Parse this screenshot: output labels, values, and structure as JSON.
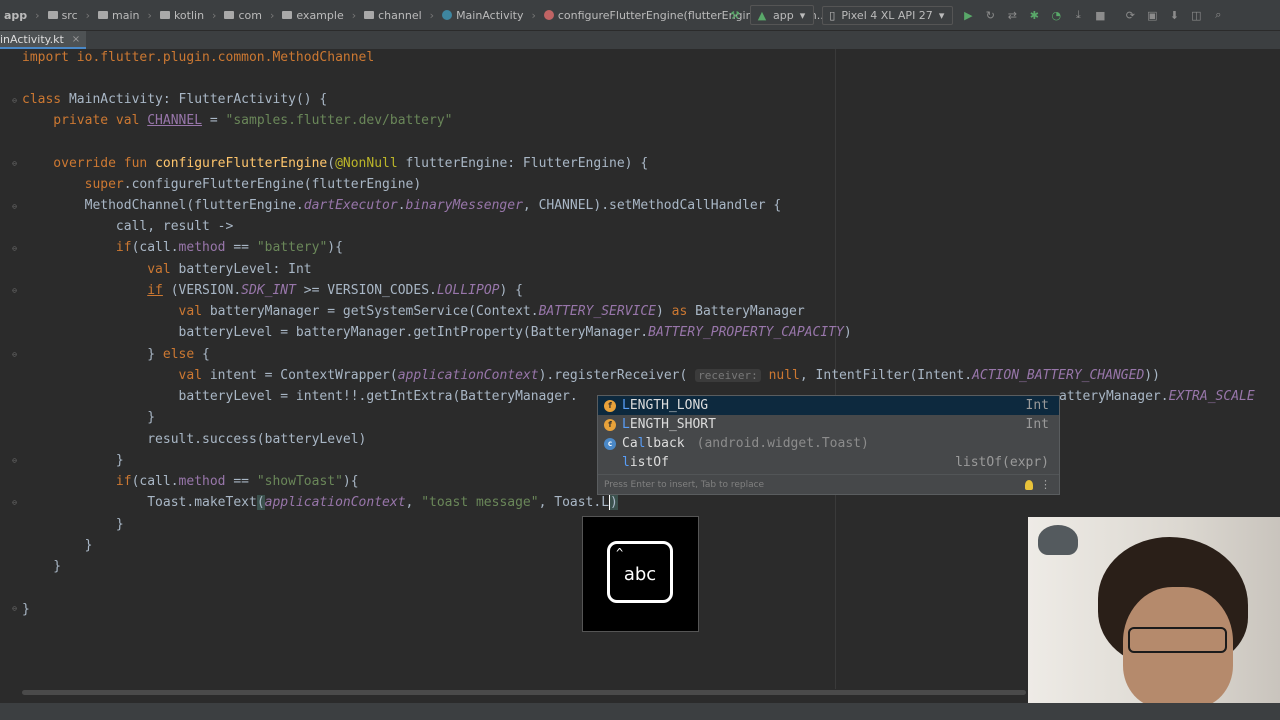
{
  "breadcrumbs": [
    {
      "label": "app",
      "icon": "folder-icon",
      "bold": true
    },
    {
      "label": "src",
      "icon": "folder-icon"
    },
    {
      "label": "main",
      "icon": "folder-icon"
    },
    {
      "label": "kotlin",
      "icon": "folder-icon"
    },
    {
      "label": "com",
      "icon": "folder-icon"
    },
    {
      "label": "example",
      "icon": "folder-icon"
    },
    {
      "label": "channel",
      "icon": "folder-icon"
    },
    {
      "label": "MainActivity",
      "icon": "class-icon"
    },
    {
      "label": "configureFlutterEngine(flutterEngine: FlutterEn...",
      "icon": "function-icon"
    }
  ],
  "toolbar": {
    "run_config": "app",
    "device": "Pixel 4 XL API 27"
  },
  "tab": {
    "label": "inActivity.kt",
    "close": "×"
  },
  "code": {
    "l1": "import io.flutter.plugin.common.MethodChannel",
    "l2a": "class ",
    "l2b": "MainActivity: FlutterActivity() {",
    "l3a": "    private val ",
    "l3b": "CHANNEL",
    "l3c": " = ",
    "l3d": "\"samples.flutter.dev/battery\"",
    "l4a": "    override fun ",
    "l4b": "configureFlutterEngine",
    "l4c": "(",
    "l4d": "@NonNull",
    "l4e": " flutterEngine: FlutterEngine) {",
    "l5a": "        ",
    "l5b": "super",
    "l5c": ".configureFlutterEngine(flutterEngine)",
    "l6a": "        MethodChannel(flutterEngine.",
    "l6b": "dartExecutor",
    "l6c": ".",
    "l6d": "binaryMessenger",
    "l6e": ", CHANNEL).setMethodCallHandler {",
    "l7": "            call, result ->",
    "l8a": "            ",
    "l8b": "if",
    "l8c": "(call.",
    "l8d": "method",
    "l8e": " == ",
    "l8f": "\"battery\"",
    "l8g": "){",
    "l9a": "                ",
    "l9b": "val",
    "l9c": " batteryLevel: Int",
    "l10a": "                ",
    "l10b": "if",
    "l10c": " (VERSION.",
    "l10d": "SDK_INT",
    "l10e": " >= VERSION_CODES.",
    "l10f": "LOLLIPOP",
    "l10g": ") {",
    "l11a": "                    ",
    "l11b": "val",
    "l11c": " batteryManager = getSystemService(Context.",
    "l11d": "BATTERY_SERVICE",
    "l11e": ") ",
    "l11f": "as",
    "l11g": " BatteryManager",
    "l12a": "                    batteryLevel = batteryManager.getIntProperty(BatteryManager.",
    "l12b": "BATTERY_PROPERTY_CAPACITY",
    "l12c": ")",
    "l13a": "                } ",
    "l13b": "else",
    "l13c": " {",
    "l14a": "                    ",
    "l14b": "val",
    "l14c": " intent = ContextWrapper(",
    "l14d": "applicationContext",
    "l14e": ").registerReceiver( ",
    "l14f": "receiver:",
    "l14g": " ",
    "l14h": "null",
    "l14i": ", IntentFilter(Intent.",
    "l14j": "ACTION_BATTERY_CHANGED",
    "l14k": "))",
    "l15a": "                    batteryLevel = intent!!.getIntExtra(BatteryManager.",
    "l15b": "atteryManager.",
    "l15c": "EXTRA_SCALE",
    "l16": "                }",
    "l17": "                result.success(batteryLevel)",
    "l18": "            }",
    "l19a": "            ",
    "l19b": "if",
    "l19c": "(call.",
    "l19d": "method",
    "l19e": " == ",
    "l19f": "\"showToast\"",
    "l19g": "){",
    "l20a": "                Toast.",
    "l20b": "makeText",
    "l20c": "(",
    "l20d": "applicationContext",
    "l20e": ", ",
    "l20f": "\"toast message\"",
    "l20g": ", Toast.L",
    "l20h": ")",
    "l21": "            }",
    "l22": "        }",
    "l23": "    }",
    "l24": "}"
  },
  "completion": {
    "items": [
      {
        "match": "L",
        "rest": "ENGTH_LONG",
        "detail": "",
        "type": "Int",
        "icon": "field-icon"
      },
      {
        "match": "L",
        "rest": "ENGTH_SHORT",
        "detail": "",
        "type": "Int",
        "icon": "field-icon"
      },
      {
        "match": "",
        "pre": "Ca",
        "match2": "l",
        "rest": "lback",
        "detail": "(android.widget.Toast)",
        "type": "",
        "icon": "class-icon"
      },
      {
        "match": "",
        "pre": "",
        "match2": "l",
        "rest": "istOf",
        "detail": "",
        "type": "listOf(expr)",
        "icon": "none"
      }
    ],
    "footer": "Press Enter to insert, Tab to replace"
  },
  "key_overlay": {
    "label": "abc"
  },
  "colors": {
    "background": "#2b2b2b",
    "keyword": "#cc7832",
    "string": "#6a8759",
    "function": "#ffc66d",
    "property": "#9876aa",
    "annotation": "#bbb529"
  }
}
